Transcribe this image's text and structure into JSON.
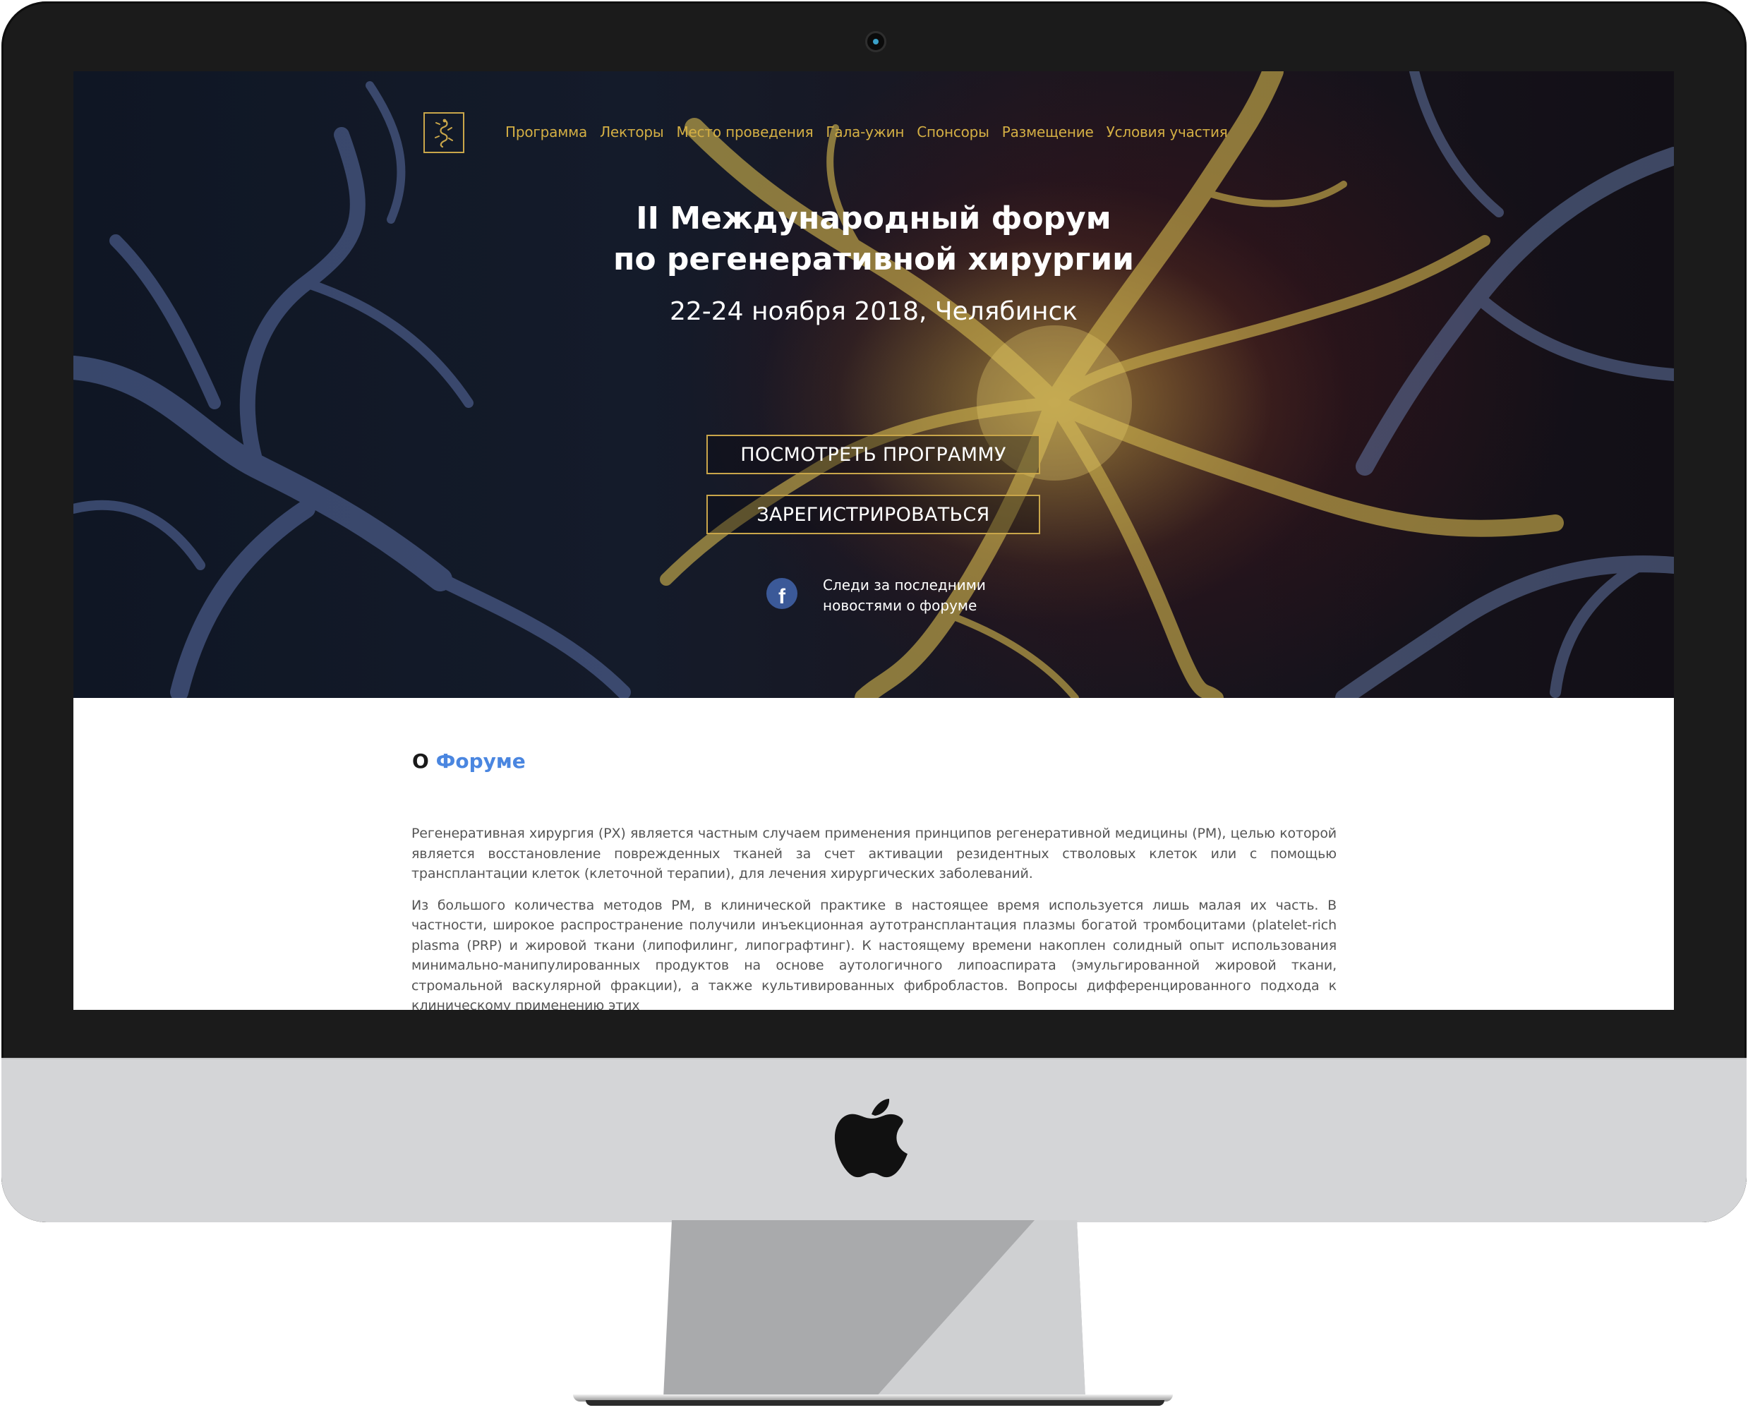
{
  "site": {
    "nav": [
      "Программа",
      "Лекторы",
      "Место проведения",
      "Гала-ужин",
      "Спонсоры",
      "Размещение",
      "Условия участия"
    ]
  },
  "hero": {
    "title_line1": "II Международный форум",
    "title_line2": "по регенеративной хирургии",
    "date_place": "22-24 ноября 2018, Челябинск",
    "btn_program": "ПОСМОТРЕТЬ ПРОГРАММУ",
    "btn_register": "ЗАРЕГИСТРИРОВАТЬСЯ",
    "social_line1": "Следи за последними",
    "social_line2": "новостями о форуме"
  },
  "about": {
    "heading_prefix": "О",
    "heading_accent": "Форуме",
    "paragraph1": "Регенеративная хирургия (РХ) является частным случаем применения принципов регенеративной медицины (РМ), целью которой является восстановление поврежденных тканей за счет активации резидентных стволовых клеток или с помощью трансплантации клеток (клеточной терапии), для лечения хирургических заболеваний.",
    "paragraph2": "Из большого количества методов РМ, в клинической практике в настоящее время используется лишь малая их часть. В частности, широкое распространение получили инъекционная аутотрансплантация плазмы богатой тромбоцитами (platelet-rich plasma (PRP) и жировой ткани (липофилинг, липографтинг). К настоящему времени накоплен солидный опыт использования минимально-манипулированных продуктов на основе аутологичного липоаспирата (эмульгированной жировой ткани, стромальной васкулярной фракции), а также культивированных фибробластов. Вопросы дифференцированного подхода к клиническому применению этих"
  },
  "colors": {
    "accent_gold": "#c9a64a",
    "heading_blue": "#4a86e0",
    "facebook_blue": "#3b5998"
  },
  "icons": [
    "camera-icon",
    "lizard-logo-icon",
    "facebook-icon",
    "apple-logo-icon"
  ]
}
